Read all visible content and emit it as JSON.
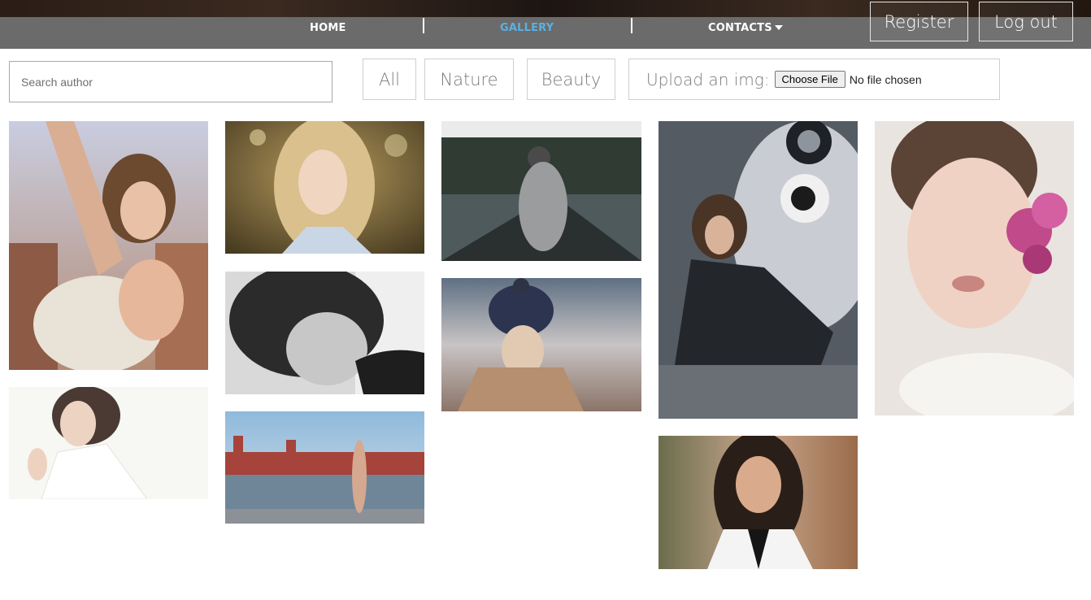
{
  "nav": {
    "home": "HOME",
    "gallery": "GALLERY",
    "contacts": "CONTACTS",
    "active_color": "#5bb0e2"
  },
  "auth": {
    "register": "Register",
    "logout": "Log out"
  },
  "search": {
    "placeholder": "Search author",
    "value": ""
  },
  "filters": [
    "All",
    "Nature",
    "Beauty"
  ],
  "upload": {
    "label": "Upload an img:",
    "button": "Choose File",
    "status": "No file chosen"
  },
  "gallery": {
    "photos": [
      {
        "subject": "woman with windswept hair holding towel"
      },
      {
        "subject": "woman in white top, soft light"
      },
      {
        "subject": "blonde woman with wavy hair"
      },
      {
        "subject": "black and white portrait, hair over face"
      },
      {
        "subject": "woman in dress on embankment near red fortress"
      },
      {
        "subject": "woman in grey sweater on bridge by forest"
      },
      {
        "subject": "woman in star beanie over city"
      },
      {
        "subject": "woman sitting in front of owl graffiti"
      },
      {
        "subject": "woman with headpiece and black bow"
      },
      {
        "subject": "woman with pink flower over eye"
      }
    ]
  }
}
